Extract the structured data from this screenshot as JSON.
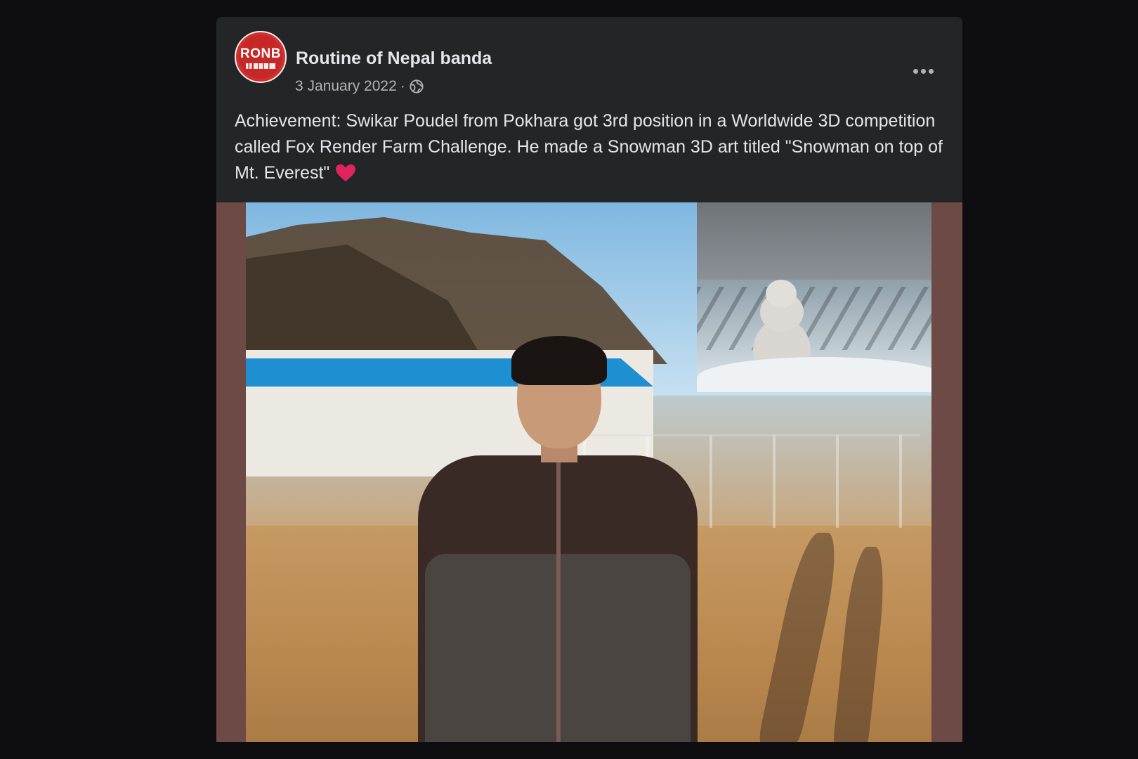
{
  "post": {
    "page_name": "Routine of Nepal banda",
    "avatar_text": "RONB",
    "date": "3 January 2022",
    "separator": "·",
    "privacy_icon": "globe-icon",
    "more_icon": "more-options-icon",
    "text": "Achievement: Swikar Poudel from Pokhara got 3rd position in a Worldwide 3D competition called Fox Render Farm Challenge. He made a Snowman 3D art titled \"Snowman on top of Mt. Everest\"",
    "emoji": "heart-icon"
  },
  "colors": {
    "background": "#0e0e10",
    "card": "#242526",
    "text_primary": "#e4e6eb",
    "text_secondary": "#b0b3b8",
    "avatar_red": "#d32f2f",
    "media_border": "#6d4a45",
    "heart": "#e0245e"
  }
}
